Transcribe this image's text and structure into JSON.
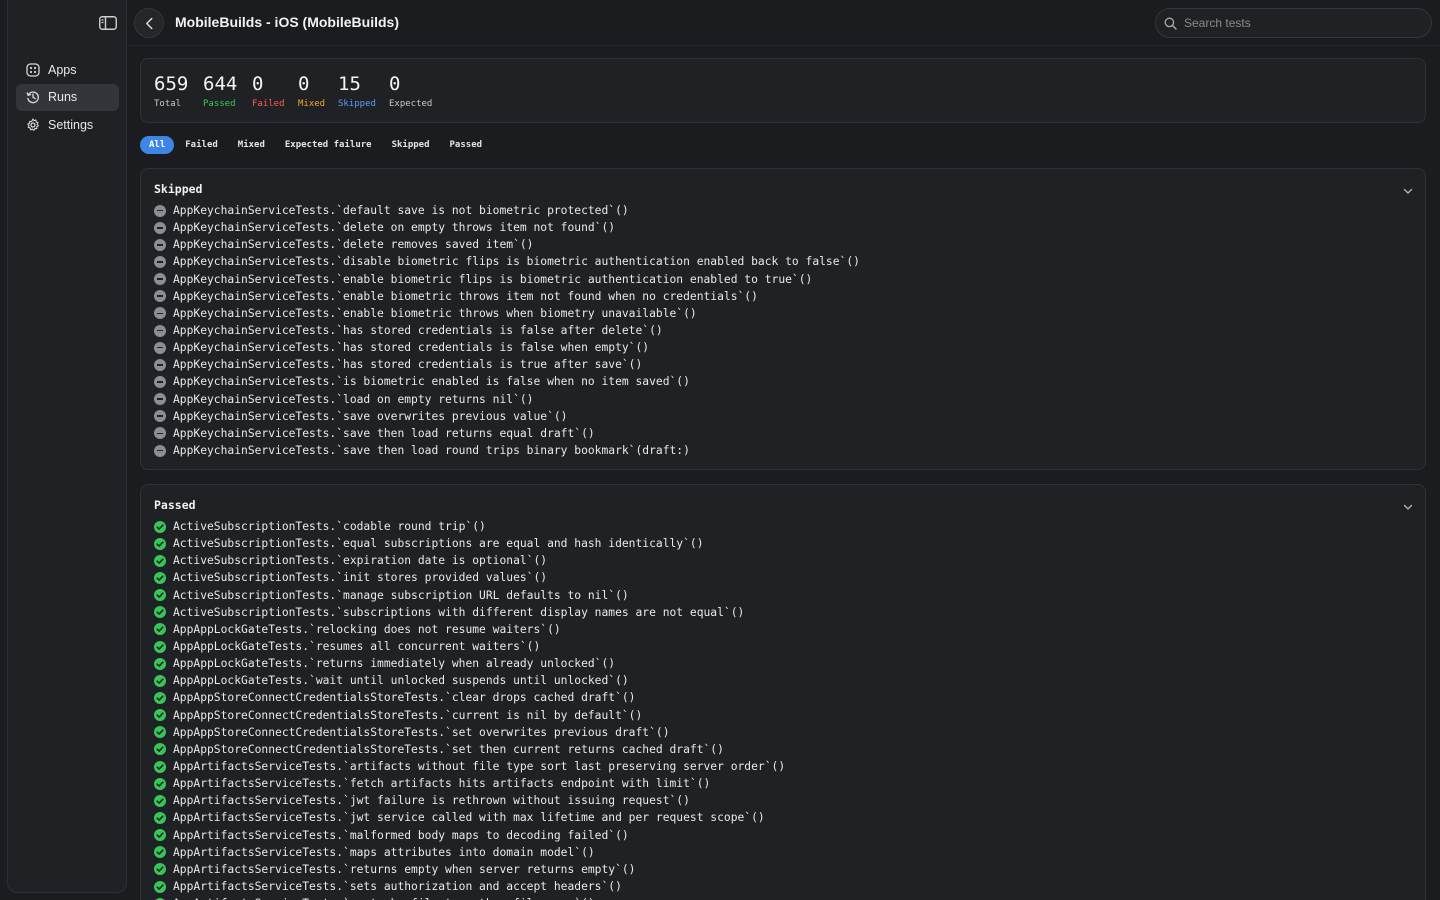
{
  "header": {
    "title": "MobileBuilds - iOS (MobileBuilds)",
    "search_placeholder": "Search tests"
  },
  "sidebar": {
    "items": [
      {
        "label": "Apps",
        "icon": "apps-icon",
        "active": false
      },
      {
        "label": "Runs",
        "icon": "history-icon",
        "active": true
      },
      {
        "label": "Settings",
        "icon": "gear-icon",
        "active": false
      }
    ]
  },
  "stats": [
    {
      "value": "659",
      "label": "Total",
      "color": "#c9c9c9"
    },
    {
      "value": "644",
      "label": "Passed",
      "color": "#35c759"
    },
    {
      "value": "0",
      "label": "Failed",
      "color": "#ff5a4f"
    },
    {
      "value": "0",
      "label": "Mixed",
      "color": "#f0a33c"
    },
    {
      "value": "15",
      "label": "Skipped",
      "color": "#5b9cf5"
    },
    {
      "value": "0",
      "label": "Expected",
      "color": "#c9c9c9"
    }
  ],
  "filters": [
    "All",
    "Failed",
    "Mixed",
    "Expected failure",
    "Skipped",
    "Passed"
  ],
  "active_filter": "All",
  "sections": [
    {
      "title": "Skipped",
      "status": "skip",
      "tests": [
        "AppKeychainServiceTests.`default save is not biometric protected`()",
        "AppKeychainServiceTests.`delete on empty throws item not found`()",
        "AppKeychainServiceTests.`delete removes saved item`()",
        "AppKeychainServiceTests.`disable biometric flips is biometric authentication enabled back to false`()",
        "AppKeychainServiceTests.`enable biometric flips is biometric authentication enabled to true`()",
        "AppKeychainServiceTests.`enable biometric throws item not found when no credentials`()",
        "AppKeychainServiceTests.`enable biometric throws when biometry unavailable`()",
        "AppKeychainServiceTests.`has stored credentials is false after delete`()",
        "AppKeychainServiceTests.`has stored credentials is false when empty`()",
        "AppKeychainServiceTests.`has stored credentials is true after save`()",
        "AppKeychainServiceTests.`is biometric enabled is false when no item saved`()",
        "AppKeychainServiceTests.`load on empty returns nil`()",
        "AppKeychainServiceTests.`save overwrites previous value`()",
        "AppKeychainServiceTests.`save then load returns equal draft`()",
        "AppKeychainServiceTests.`save then load round trips binary bookmark`(draft:)"
      ]
    },
    {
      "title": "Passed",
      "status": "pass",
      "tests": [
        "ActiveSubscriptionTests.`codable round trip`()",
        "ActiveSubscriptionTests.`equal subscriptions are equal and hash identically`()",
        "ActiveSubscriptionTests.`expiration date is optional`()",
        "ActiveSubscriptionTests.`init stores provided values`()",
        "ActiveSubscriptionTests.`manage subscription URL defaults to nil`()",
        "ActiveSubscriptionTests.`subscriptions with different display names are not equal`()",
        "AppAppLockGateTests.`relocking does not resume waiters`()",
        "AppAppLockGateTests.`resumes all concurrent waiters`()",
        "AppAppLockGateTests.`returns immediately when already unlocked`()",
        "AppAppLockGateTests.`wait until unlocked suspends until unlocked`()",
        "AppAppStoreConnectCredentialsStoreTests.`clear drops cached draft`()",
        "AppAppStoreConnectCredentialsStoreTests.`current is nil by default`()",
        "AppAppStoreConnectCredentialsStoreTests.`set overwrites previous draft`()",
        "AppAppStoreConnectCredentialsStoreTests.`set then current returns cached draft`()",
        "AppArtifactsServiceTests.`artifacts without file type sort last preserving server order`()",
        "AppArtifactsServiceTests.`fetch artifacts hits artifacts endpoint with limit`()",
        "AppArtifactsServiceTests.`jwt failure is rethrown without issuing request`()",
        "AppArtifactsServiceTests.`jwt service called with max lifetime and per request scope`()",
        "AppArtifactsServiceTests.`malformed body maps to decoding failed`()",
        "AppArtifactsServiceTests.`maps attributes into domain model`()",
        "AppArtifactsServiceTests.`returns empty when server returns empty`()",
        "AppArtifactsServiceTests.`sets authorization and accept headers`()",
        "AppArtifactsServiceTests.`sorts by file type then file name`()"
      ]
    }
  ]
}
